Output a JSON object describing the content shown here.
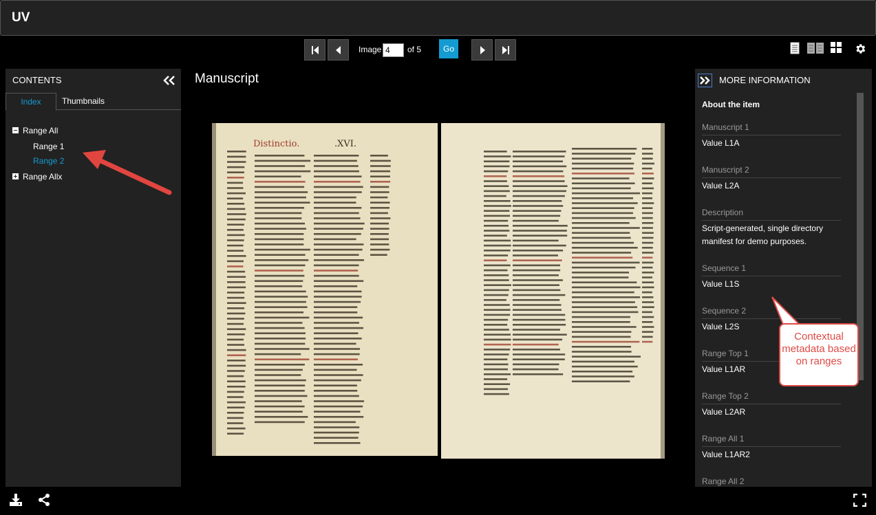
{
  "app": {
    "title": "UV"
  },
  "pager": {
    "image_label": "Image",
    "current_image": "4",
    "of_label": "of 5",
    "go_label": "Go"
  },
  "contents": {
    "header": "CONTENTS",
    "tabs": [
      {
        "label": "Index",
        "active": true
      },
      {
        "label": "Thumbnails",
        "active": false
      }
    ],
    "tree": [
      {
        "label": "Range All",
        "expanded": true
      },
      {
        "label": "Range 1"
      },
      {
        "label": "Range 2",
        "selected": true
      },
      {
        "label": "Range Allx",
        "expanded": false
      }
    ]
  },
  "center": {
    "title": "Manuscript"
  },
  "more_info": {
    "header": "MORE INFORMATION",
    "section_title": "About the item",
    "items": [
      {
        "label": "Manuscript 1",
        "value": "Value L1A"
      },
      {
        "label": "Manuscript 2",
        "value": "Value L2A"
      },
      {
        "label": "Description",
        "value": "Script-generated, single directory manifest for demo purposes."
      },
      {
        "label": "Sequence 1",
        "value": "Value L1S"
      },
      {
        "label": "Sequence 2",
        "value": "Value L2S"
      },
      {
        "label": "Range Top 1",
        "value": "Value L1AR"
      },
      {
        "label": "Range Top 2",
        "value": "Value L2AR"
      },
      {
        "label": "Range All 1",
        "value": "Value L1AR2"
      },
      {
        "label": "Range All 2",
        "value": ""
      }
    ]
  },
  "annotation": {
    "callout_text": "Contextual metadata based on ranges"
  },
  "colors": {
    "accent": "#149bd1",
    "annotation_red": "#dd4a45",
    "panel_bg": "#222222"
  }
}
